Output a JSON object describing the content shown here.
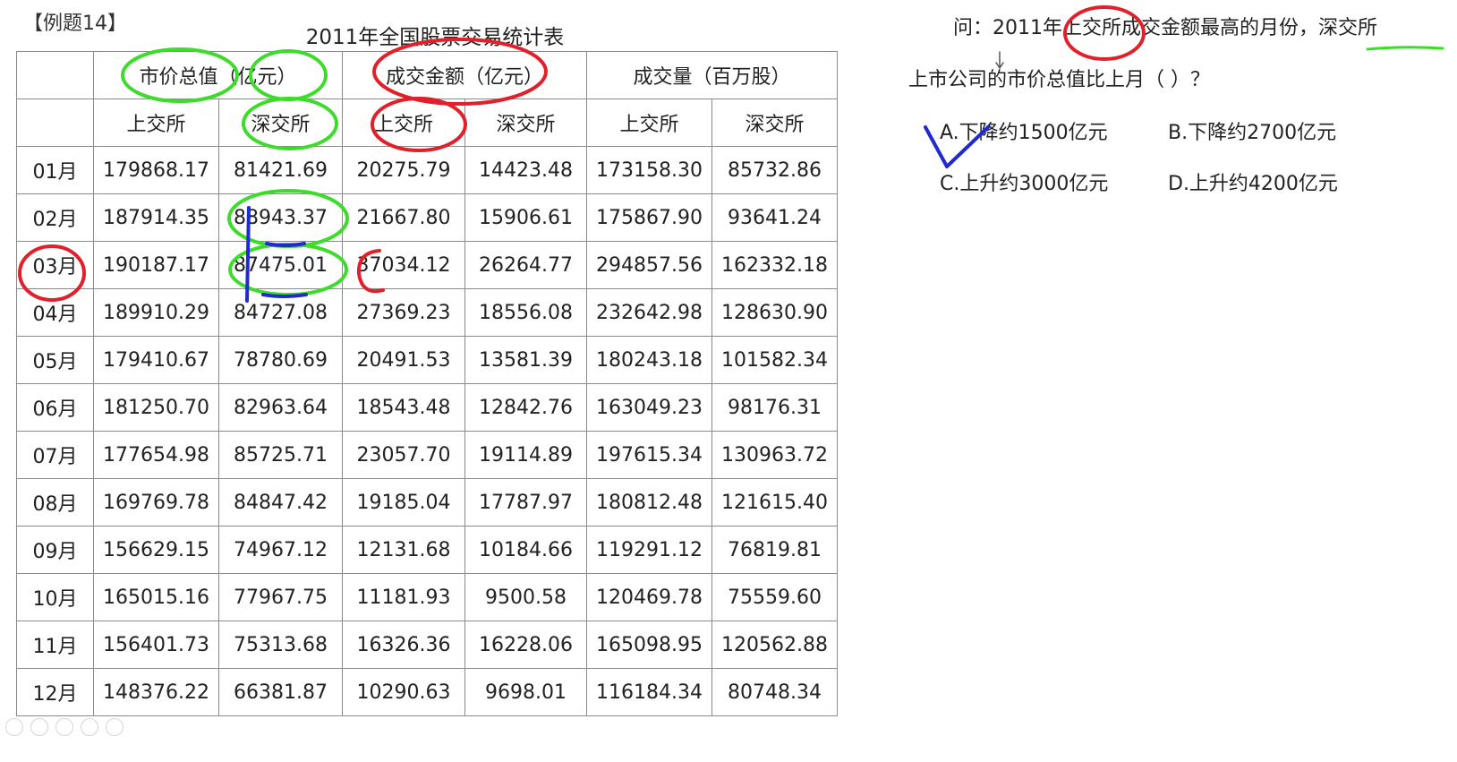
{
  "example_label": "【例题14】",
  "table": {
    "title": "2011年全国股票交易统计表",
    "group_headers": [
      "市价总值（亿元）",
      "成交金额（亿元）",
      "成交量（百万股）"
    ],
    "sub_headers": [
      "上交所",
      "深交所",
      "上交所",
      "深交所",
      "上交所",
      "深交所"
    ],
    "rows": [
      {
        "month": "01月",
        "values": [
          "179868.17",
          "81421.69",
          "20275.79",
          "14423.48",
          "173158.30",
          "85732.86"
        ]
      },
      {
        "month": "02月",
        "values": [
          "187914.35",
          "88943.37",
          "21667.80",
          "15906.61",
          "175867.90",
          "93641.24"
        ]
      },
      {
        "month": "03月",
        "values": [
          "190187.17",
          "87475.01",
          "37034.12",
          "26264.77",
          "294857.56",
          "162332.18"
        ]
      },
      {
        "month": "04月",
        "values": [
          "189910.29",
          "84727.08",
          "27369.23",
          "18556.08",
          "232642.98",
          "128630.90"
        ]
      },
      {
        "month": "05月",
        "values": [
          "179410.67",
          "78780.69",
          "20491.53",
          "13581.39",
          "180243.18",
          "101582.34"
        ]
      },
      {
        "month": "06月",
        "values": [
          "181250.70",
          "82963.64",
          "18543.48",
          "12842.76",
          "163049.23",
          "98176.31"
        ]
      },
      {
        "month": "07月",
        "values": [
          "177654.98",
          "85725.71",
          "23057.70",
          "19114.89",
          "197615.34",
          "130963.72"
        ]
      },
      {
        "month": "08月",
        "values": [
          "169769.78",
          "84847.42",
          "19185.04",
          "17787.97",
          "180812.48",
          "121615.40"
        ]
      },
      {
        "month": "09月",
        "values": [
          "156629.15",
          "74967.12",
          "12131.68",
          "10184.66",
          "119291.12",
          "76819.81"
        ]
      },
      {
        "month": "10月",
        "values": [
          "165015.16",
          "77967.75",
          "11181.93",
          "9500.58",
          "120469.78",
          "75559.60"
        ]
      },
      {
        "month": "11月",
        "values": [
          "156401.73",
          "75313.68",
          "16326.36",
          "16228.06",
          "165098.95",
          "120562.88"
        ]
      },
      {
        "month": "12月",
        "values": [
          "148376.22",
          "66381.87",
          "10290.63",
          "9698.01",
          "116184.34",
          "80748.34"
        ]
      }
    ]
  },
  "question": {
    "line1": "问：2011年上交所成交金额最高的月份，深交所",
    "line2": "上市公司的市价总值比上月（  ）？",
    "options": {
      "a": "A.下降约1500亿元",
      "b": "B.下降约2700亿元",
      "c": "C.上升约3000亿元",
      "d": "D.上升约4200亿元"
    }
  },
  "annotation_colors": {
    "green": "#3ddc2c",
    "red": "#e0202a",
    "blue": "#1f2ad1"
  }
}
